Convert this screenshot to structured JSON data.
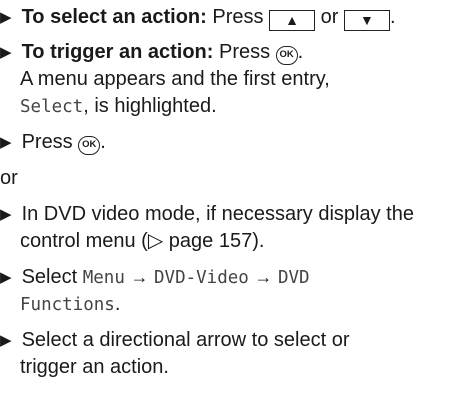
{
  "bullet": "▶",
  "lines": {
    "l1": {
      "bold": "To select an action:",
      "text": "Press",
      "key1": "▲",
      "or": "or",
      "key2": "▼",
      "end": "."
    },
    "l2": {
      "bold": "To trigger an action:",
      "text": "Press",
      "ok": "OK",
      "end": "."
    },
    "l3": {
      "text": "A menu appears and the first entry,"
    },
    "l4": {
      "mono": "Select",
      "text": ", is highlighted."
    },
    "l5": {
      "text": "Press",
      "ok": "OK",
      "end": "."
    },
    "l6": {
      "text": "or"
    },
    "l7": {
      "text": "In DVD video mode, if necessary display the"
    },
    "l8": {
      "text": "control menu (▷ page 157)."
    },
    "l9": {
      "text": "Select",
      "m1": "Menu",
      "a1": "→",
      "m2": "DVD-Video",
      "a2": "→",
      "m3": "DVD"
    },
    "l10": {
      "m1": "Functions",
      "end": "."
    },
    "l11": {
      "text": "Select a directional arrow to select or"
    },
    "l12": {
      "text": "trigger an action."
    }
  }
}
